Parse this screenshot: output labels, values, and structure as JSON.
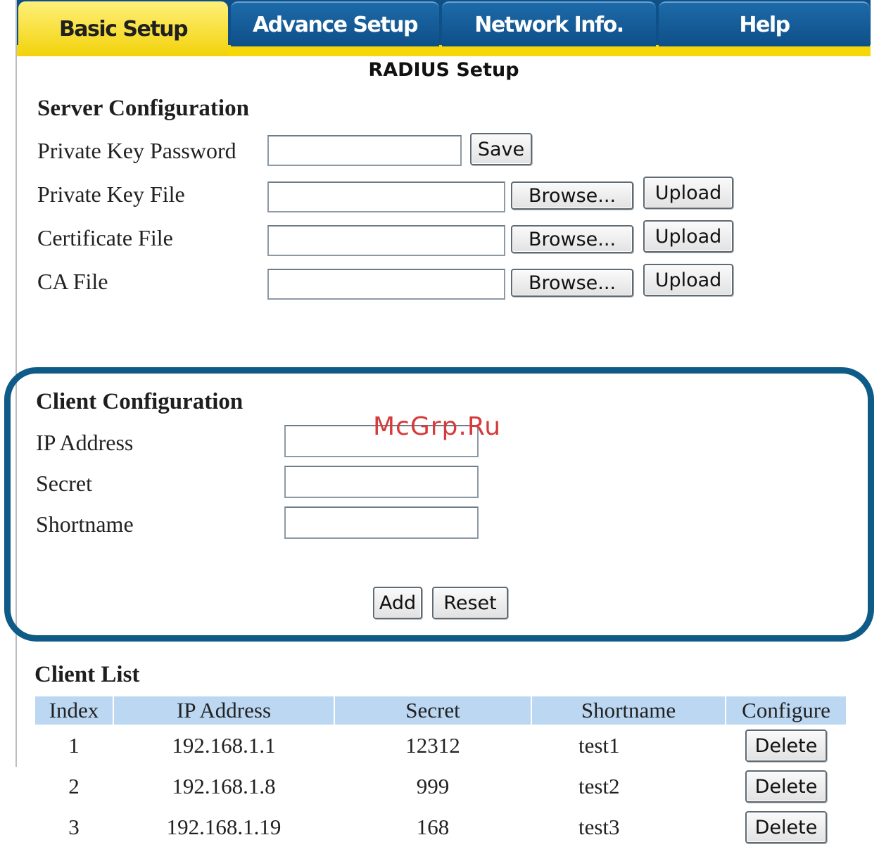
{
  "tabs": [
    {
      "label": "Basic Setup",
      "active": true
    },
    {
      "label": "Advance Setup",
      "active": false
    },
    {
      "label": "Network Info.",
      "active": false
    },
    {
      "label": "Help",
      "active": false
    }
  ],
  "page_title": "RADIUS Setup",
  "server_config": {
    "title": "Server Configuration",
    "private_key_password_label": "Private Key Password",
    "save_label": "Save",
    "private_key_file_label": "Private Key File",
    "certificate_file_label": "Certificate File",
    "ca_file_label": "CA File",
    "browse_label": "Browse...",
    "upload_label": "Upload",
    "private_key_password_value": "",
    "private_key_file_value": "",
    "certificate_file_value": "",
    "ca_file_value": ""
  },
  "client_config": {
    "title": "Client Configuration",
    "ip_label": "IP Address",
    "secret_label": "Secret",
    "shortname_label": "Shortname",
    "ip_value": "",
    "secret_value": "",
    "shortname_value": "",
    "add_label": "Add",
    "reset_label": "Reset"
  },
  "watermark": "McGrp.Ru",
  "client_list": {
    "title": "Client List",
    "columns": [
      "Index",
      "IP Address",
      "Secret",
      "Shortname",
      "Configure"
    ],
    "rows": [
      {
        "index": "1",
        "ip": "192.168.1.1",
        "secret": "12312",
        "shortname": "test1",
        "action": "Delete"
      },
      {
        "index": "2",
        "ip": "192.168.1.8",
        "secret": "999",
        "shortname": "test2",
        "action": "Delete"
      },
      {
        "index": "3",
        "ip": "192.168.1.19",
        "secret": "168",
        "shortname": "test3",
        "action": "Delete"
      }
    ]
  },
  "colors": {
    "tab_active": "#f5d70a",
    "tab_inactive": "#0f5089",
    "highlight_border": "#0e5b87",
    "table_header": "#bcd7f2",
    "watermark": "#d63a3a"
  }
}
